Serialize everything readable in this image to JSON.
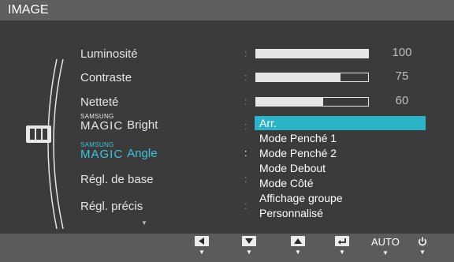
{
  "header": {
    "title": "IMAGE"
  },
  "menu": {
    "items": [
      {
        "label": "Luminosité",
        "value": "100",
        "level": 1.0
      },
      {
        "label": "Contraste",
        "value": "75",
        "level": 0.75
      },
      {
        "label": "Netteté",
        "value": "60",
        "level": 0.6
      }
    ],
    "magic_bright": {
      "brand_small": "SAMSUNG",
      "brand_big": "MAGIC",
      "label": "Bright"
    },
    "magic_angle": {
      "brand_small": "SAMSUNG",
      "brand_big": "MAGIC",
      "label": "Angle"
    },
    "regl_base": "Régl. de base",
    "regl_precis": "Régl. précis",
    "scroll_indicator": "▼"
  },
  "dropdown": {
    "options": [
      "Arr.",
      "Mode Penché 1",
      "Mode Penché 2",
      "Mode Debout",
      "Mode Côté",
      "Affichage groupe",
      "Personnalisé"
    ],
    "selected_index": 0
  },
  "footer": {
    "auto_label": "AUTO",
    "arrow_glyph": "▼",
    "buttons": [
      "left-button",
      "down-button",
      "up-button",
      "enter-button",
      "auto-button",
      "power-button"
    ]
  },
  "colors": {
    "background": "#3b3b3b",
    "titlebar": "#5f5f5f",
    "highlight": "#2bb3c8",
    "angle_label": "#3ec3dd",
    "footer": "#5b5b5b"
  }
}
